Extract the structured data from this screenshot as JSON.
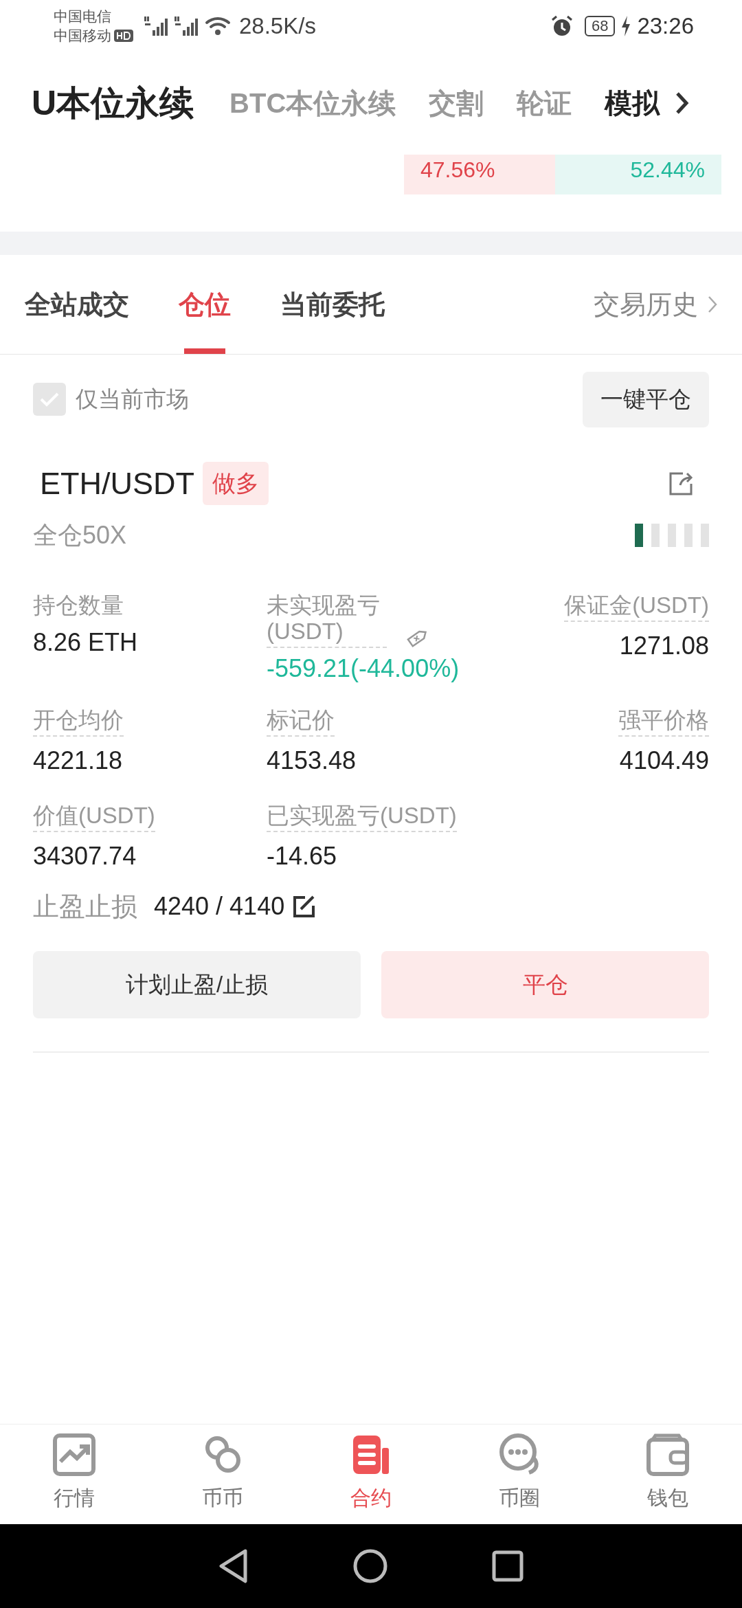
{
  "status_bar": {
    "carriers": [
      "中国电信",
      "中国移动"
    ],
    "speed": "28.5K/s",
    "battery": "68",
    "time": "23:26"
  },
  "market_tabs": [
    {
      "label": "U本位永续",
      "selected": true,
      "kind": "normal"
    },
    {
      "label": "BTC本位永续",
      "selected": false,
      "kind": "normal"
    },
    {
      "label": "交割",
      "selected": false,
      "kind": "normal"
    },
    {
      "label": "轮证",
      "selected": false,
      "kind": "normal"
    },
    {
      "label": "模拟",
      "selected": false,
      "kind": "featured"
    }
  ],
  "ratio_bar": {
    "long": "47.56%",
    "short": "52.44%",
    "level": 0.4756
  },
  "section_tabs": [
    {
      "label": "全站成交",
      "selected": false
    },
    {
      "label": "仓位",
      "selected": true
    },
    {
      "label": "当前委托",
      "selected": false
    }
  ],
  "history_link": "交易历史",
  "filter": {
    "label": "仅当前市场",
    "checked": true
  },
  "close_all_button": "一键平仓",
  "position": {
    "symbol": "ETH/USDT",
    "side": "做多",
    "margin_mode": "全仓50X",
    "risk": {
      "level": 0.2
    },
    "fields": [
      {
        "label": "持仓数量",
        "value": "8.26 ETH",
        "dotted": false
      },
      {
        "label": "未实现盈亏(USDT)",
        "value": "-559.21(-44.00%)",
        "dotted": true,
        "color": "#1fb89a",
        "hint": true
      },
      {
        "label": "保证金(USDT)",
        "value": "1271.08",
        "dotted": true
      },
      {
        "label": "开仓均价",
        "value": "4221.18",
        "dotted": true
      },
      {
        "label": "标记价",
        "value": "4153.48",
        "dotted": true
      },
      {
        "label": "强平价格",
        "value": "4104.49",
        "dotted": true
      },
      {
        "label": "价值(USDT)",
        "value": "34307.74",
        "dotted": true
      },
      {
        "label": "已实现盈亏(USDT)",
        "value": "-14.65",
        "dotted": true
      }
    ],
    "tp_sl": {
      "label": "止盈止损",
      "value": "4240 / 4140"
    },
    "buttons": [
      {
        "label": "计划止盈/止损",
        "kind": "secondary"
      },
      {
        "label": "平仓",
        "kind": "danger"
      }
    ]
  },
  "bottom_nav": [
    {
      "label": "行情",
      "selected": false
    },
    {
      "label": "币币",
      "selected": false
    },
    {
      "label": "合约",
      "selected": true
    },
    {
      "label": "币圈",
      "selected": false
    },
    {
      "label": "钱包",
      "selected": false
    }
  ]
}
